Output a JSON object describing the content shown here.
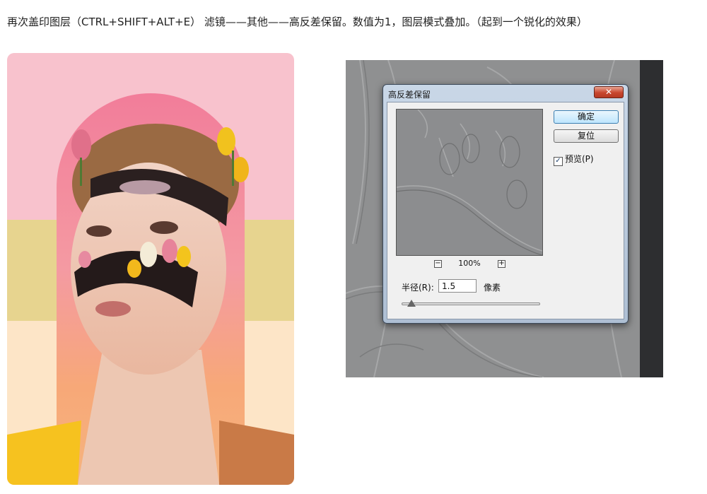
{
  "instruction_text": "再次盖印图层（CTRL+SHIFT+ALT+E） 滤镜——其他——高反差保留。数值为1，图层模式叠加。（起到一个锐化的效果）",
  "dialog": {
    "title": "高反差保留",
    "close_label": "✕",
    "ok_label": "确定",
    "reset_label": "复位",
    "preview_label": "预览(P)",
    "preview_checked": true,
    "zoom_out_label": "−",
    "zoom_in_label": "+",
    "zoom_level": "100%",
    "radius_label": "半径(R):",
    "radius_value": "1.5",
    "radius_unit": "像素"
  },
  "colors": {
    "pink_bg": "#f8c2cd",
    "yellow_band": "#e7d48f",
    "peach_band": "#fde5c7",
    "ps_gray": "#8f9091",
    "ps_panel_dark": "#2d2e30"
  },
  "icons": {
    "check": "checkmark-icon",
    "close": "close-icon"
  }
}
